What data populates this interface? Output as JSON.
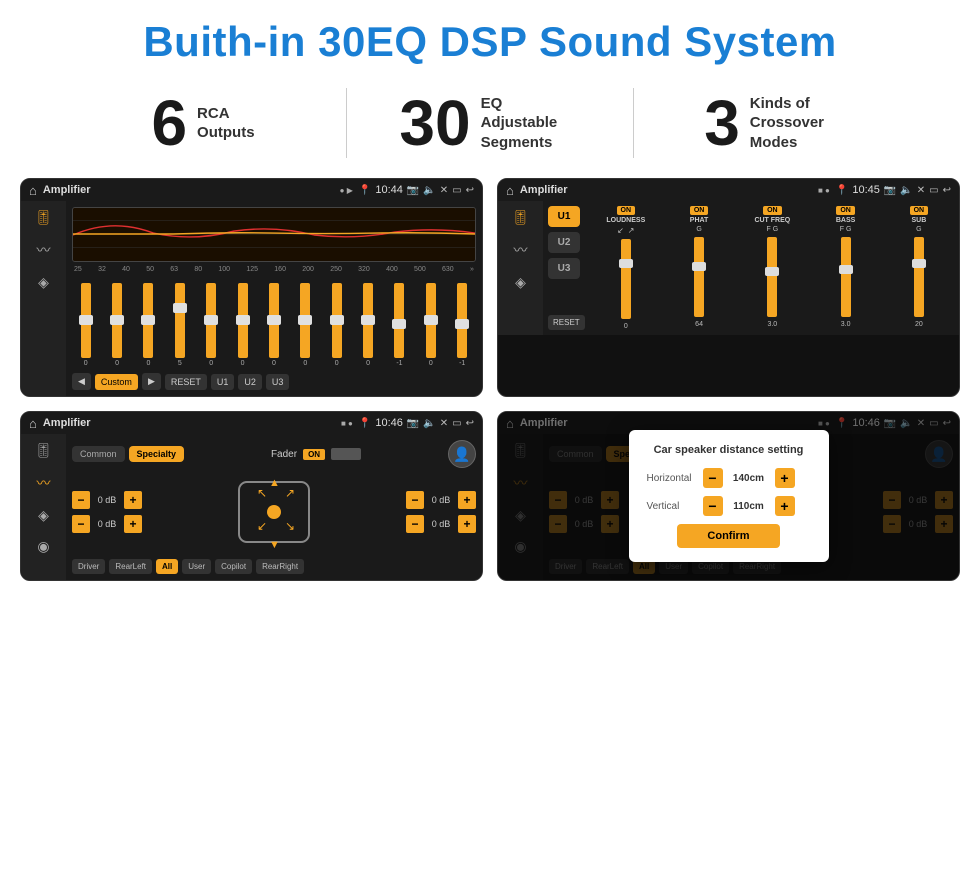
{
  "page": {
    "title": "Buith-in 30EQ DSP Sound System"
  },
  "stats": [
    {
      "number": "6",
      "label": "RCA\nOutputs"
    },
    {
      "number": "30",
      "label": "EQ Adjustable\nSegments"
    },
    {
      "number": "3",
      "label": "Kinds of\nCrossover Modes"
    }
  ],
  "screens": {
    "eq": {
      "appName": "Amplifier",
      "time": "10:44",
      "freqLabels": [
        "25",
        "32",
        "40",
        "50",
        "63",
        "80",
        "100",
        "125",
        "160",
        "200",
        "250",
        "320",
        "400",
        "500",
        "630"
      ],
      "sliderValues": [
        "0",
        "0",
        "0",
        "5",
        "0",
        "0",
        "0",
        "0",
        "0",
        "0",
        "-1",
        "0",
        "-1"
      ],
      "buttons": [
        "◀",
        "Custom",
        "▶",
        "RESET",
        "U1",
        "U2",
        "U3"
      ]
    },
    "crossover": {
      "appName": "Amplifier",
      "time": "10:45",
      "presets": [
        "U1",
        "U2",
        "U3"
      ],
      "channels": [
        {
          "on": true,
          "label": "LOUDNESS"
        },
        {
          "on": true,
          "label": "PHAT"
        },
        {
          "on": true,
          "label": "CUT FREQ"
        },
        {
          "on": true,
          "label": "BASS"
        },
        {
          "on": true,
          "label": "SUB"
        }
      ]
    },
    "fader": {
      "appName": "Amplifier",
      "time": "10:46",
      "tabs": [
        "Common",
        "Specialty"
      ],
      "faderLabel": "Fader",
      "faderOn": "ON",
      "dbValues": [
        "0 dB",
        "0 dB",
        "0 dB",
        "0 dB"
      ],
      "bottomBtns": [
        "Driver",
        "RearLeft",
        "All",
        "User",
        "Copilot",
        "RearRight"
      ]
    },
    "distance": {
      "appName": "Amplifier",
      "time": "10:46",
      "tabs": [
        "Common",
        "Specialty"
      ],
      "dialogTitle": "Car speaker distance setting",
      "horizontal": {
        "label": "Horizontal",
        "value": "140cm"
      },
      "vertical": {
        "label": "Vertical",
        "value": "110cm"
      },
      "confirmLabel": "Confirm",
      "dbValues": [
        "0 dB",
        "0 dB"
      ],
      "bottomBtns": [
        "Driver",
        "RearLeft",
        "All",
        "User",
        "Copilot",
        "RearRight"
      ]
    }
  }
}
